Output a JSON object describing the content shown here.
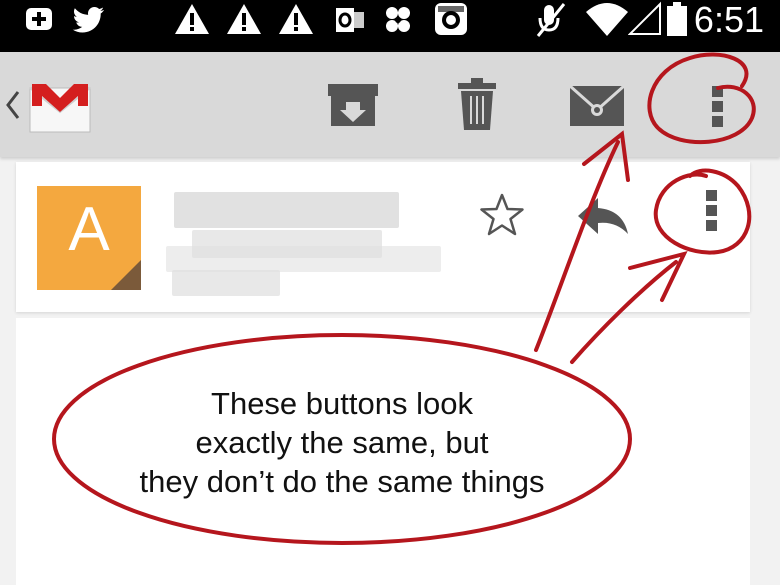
{
  "status_bar": {
    "time": "6:51",
    "icons": [
      "add-box-icon",
      "twitter-icon",
      "warning-icon",
      "warning-icon",
      "warning-icon",
      "outlook-icon",
      "pinwheel-icon",
      "instagram-icon",
      "mute-icon",
      "wifi-icon",
      "cell-signal-icon",
      "battery-icon"
    ]
  },
  "action_bar": {
    "app_icon": "gmail-logo",
    "actions": [
      "archive-icon",
      "delete-icon",
      "mark-unread-icon",
      "overflow-menu-icon"
    ]
  },
  "email": {
    "sender_initial": "A",
    "avatar_color": "#f4a83f",
    "actions": [
      "star-icon",
      "reply-icon",
      "overflow-menu-icon"
    ]
  },
  "annotation": {
    "lines": [
      "These buttons look",
      "exactly the same, but",
      "they don’t do the same things"
    ],
    "color": "#b5161d"
  }
}
